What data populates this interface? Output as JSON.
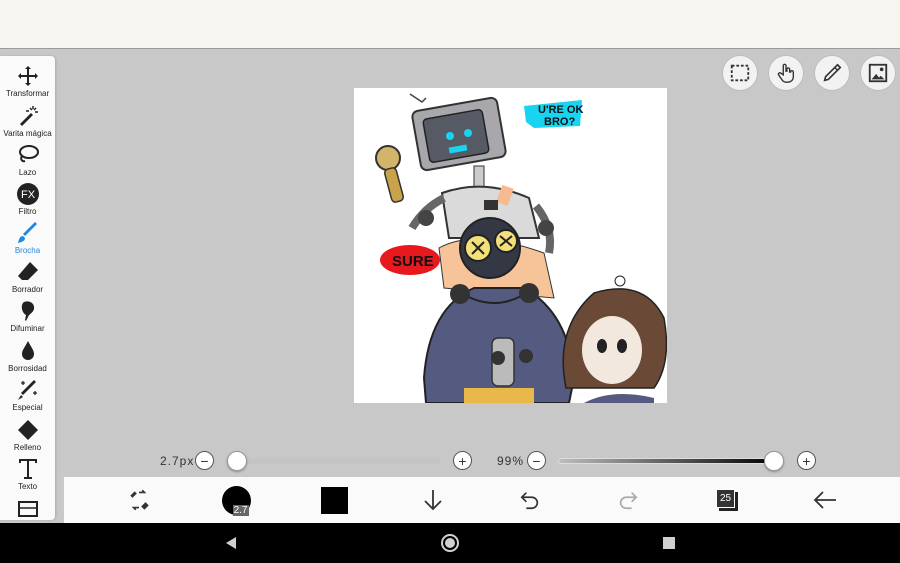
{
  "tools": [
    {
      "name": "move-icon",
      "label": "Transformar"
    },
    {
      "name": "magic-wand-icon",
      "label": "Varita mágica"
    },
    {
      "name": "lasso-icon",
      "label": "Lazo"
    },
    {
      "name": "fx-icon",
      "label": "Filtro"
    },
    {
      "name": "brush-icon",
      "label": "Brocha",
      "active": true
    },
    {
      "name": "eraser-icon",
      "label": "Borrador"
    },
    {
      "name": "smudge-icon",
      "label": "Difuminar"
    },
    {
      "name": "blur-drop-icon",
      "label": "Borrosidad"
    },
    {
      "name": "special-pen-icon",
      "label": "Especial"
    },
    {
      "name": "fill-bucket-icon",
      "label": "Relleno"
    },
    {
      "name": "text-icon",
      "label": "Texto"
    }
  ],
  "top_buttons": [
    "selection-icon",
    "hand-touch-icon",
    "pen-stylus-icon",
    "image-icon"
  ],
  "brush_size": {
    "label": "2.7px",
    "value": 0
  },
  "opacity": {
    "label": "99%",
    "value": 0.99
  },
  "bottom": {
    "brush_size_badge": "2.7",
    "layer_count": "25",
    "color": "#000000"
  },
  "canvas": {
    "bubble_top": "U'RE OK\nBRO?",
    "bubble_left": "SURE"
  },
  "colors": {
    "accent": "#1e88e5",
    "bubble_cyan": "#19d4f0",
    "bubble_red": "#e8191e",
    "hoodie": "#555a80",
    "hair": "#6a4a36"
  }
}
